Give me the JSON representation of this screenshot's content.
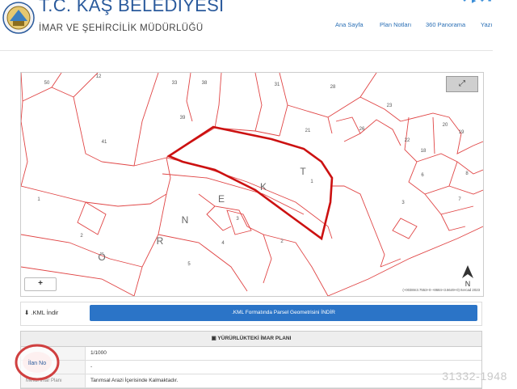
{
  "header": {
    "title": "T.C. KAŞ BELEDİYESİ",
    "subtitle": "İMAR VE ŞEHİRCİLİK MÜDÜRLÜĞÜ"
  },
  "nav": [
    {
      "label": "Ana Sayfa"
    },
    {
      "label": "Plan Notları"
    },
    {
      "label": "360 Panorama"
    },
    {
      "label": "Yazı"
    }
  ],
  "social": [
    "facebook-icon",
    "youtube-icon",
    "twitter-icon",
    "linkedin-icon"
  ],
  "map": {
    "zoom_label": "+",
    "scale_text": "(+0038m3.7553+0-+8684+3.6649+0) Itercad 2023",
    "place_name": [
      "Ö",
      "R",
      "N",
      "E",
      "K",
      "T"
    ],
    "parcels": [
      {
        "id": "p50",
        "label": "50"
      },
      {
        "id": "p12",
        "label": "12"
      },
      {
        "id": "p33",
        "label": "33"
      },
      {
        "id": "p38",
        "label": "38"
      },
      {
        "id": "p31",
        "label": "31"
      },
      {
        "id": "p28",
        "label": "28"
      },
      {
        "id": "p41",
        "label": "41"
      },
      {
        "id": "p39",
        "label": "39"
      },
      {
        "id": "p23",
        "label": "23"
      },
      {
        "id": "p21",
        "label": "21"
      },
      {
        "id": "p26",
        "label": "26"
      },
      {
        "id": "p22",
        "label": "22"
      },
      {
        "id": "p20",
        "label": "20"
      },
      {
        "id": "p19",
        "label": "19"
      },
      {
        "id": "p18",
        "label": "18"
      },
      {
        "id": "p1a",
        "label": "1"
      },
      {
        "id": "p1b",
        "label": "1"
      },
      {
        "id": "p2",
        "label": "2"
      },
      {
        "id": "p3",
        "label": "3"
      },
      {
        "id": "p4",
        "label": "4"
      },
      {
        "id": "p5",
        "label": "5"
      },
      {
        "id": "p6",
        "label": "6"
      },
      {
        "id": "p7",
        "label": "7"
      },
      {
        "id": "p8",
        "label": "8"
      },
      {
        "id": "p2b",
        "label": "2"
      },
      {
        "id": "p3b",
        "label": "3"
      }
    ]
  },
  "kml": {
    "left_label": ".KML İndir",
    "button_label": ".KML Formatında Parsel Geometrisini İNDİR"
  },
  "plan": {
    "heading": "YÜRÜRLÜKTEKİ İMAR PLANI",
    "rows": [
      {
        "label": "",
        "value": "1/1000"
      },
      {
        "label": "",
        "value": "-"
      },
      {
        "label": "Mevzi İmar Planı",
        "value": "Tarımsal Arazi İçerisinde Kalmaktadır."
      }
    ]
  },
  "stamp": {
    "text": "İlan No"
  },
  "watermark": "31332-1948",
  "colors": {
    "title": "#2a5a9c",
    "parcel_line": "#e04545",
    "highlight": "#cc1111",
    "button": "#2b74c7"
  }
}
